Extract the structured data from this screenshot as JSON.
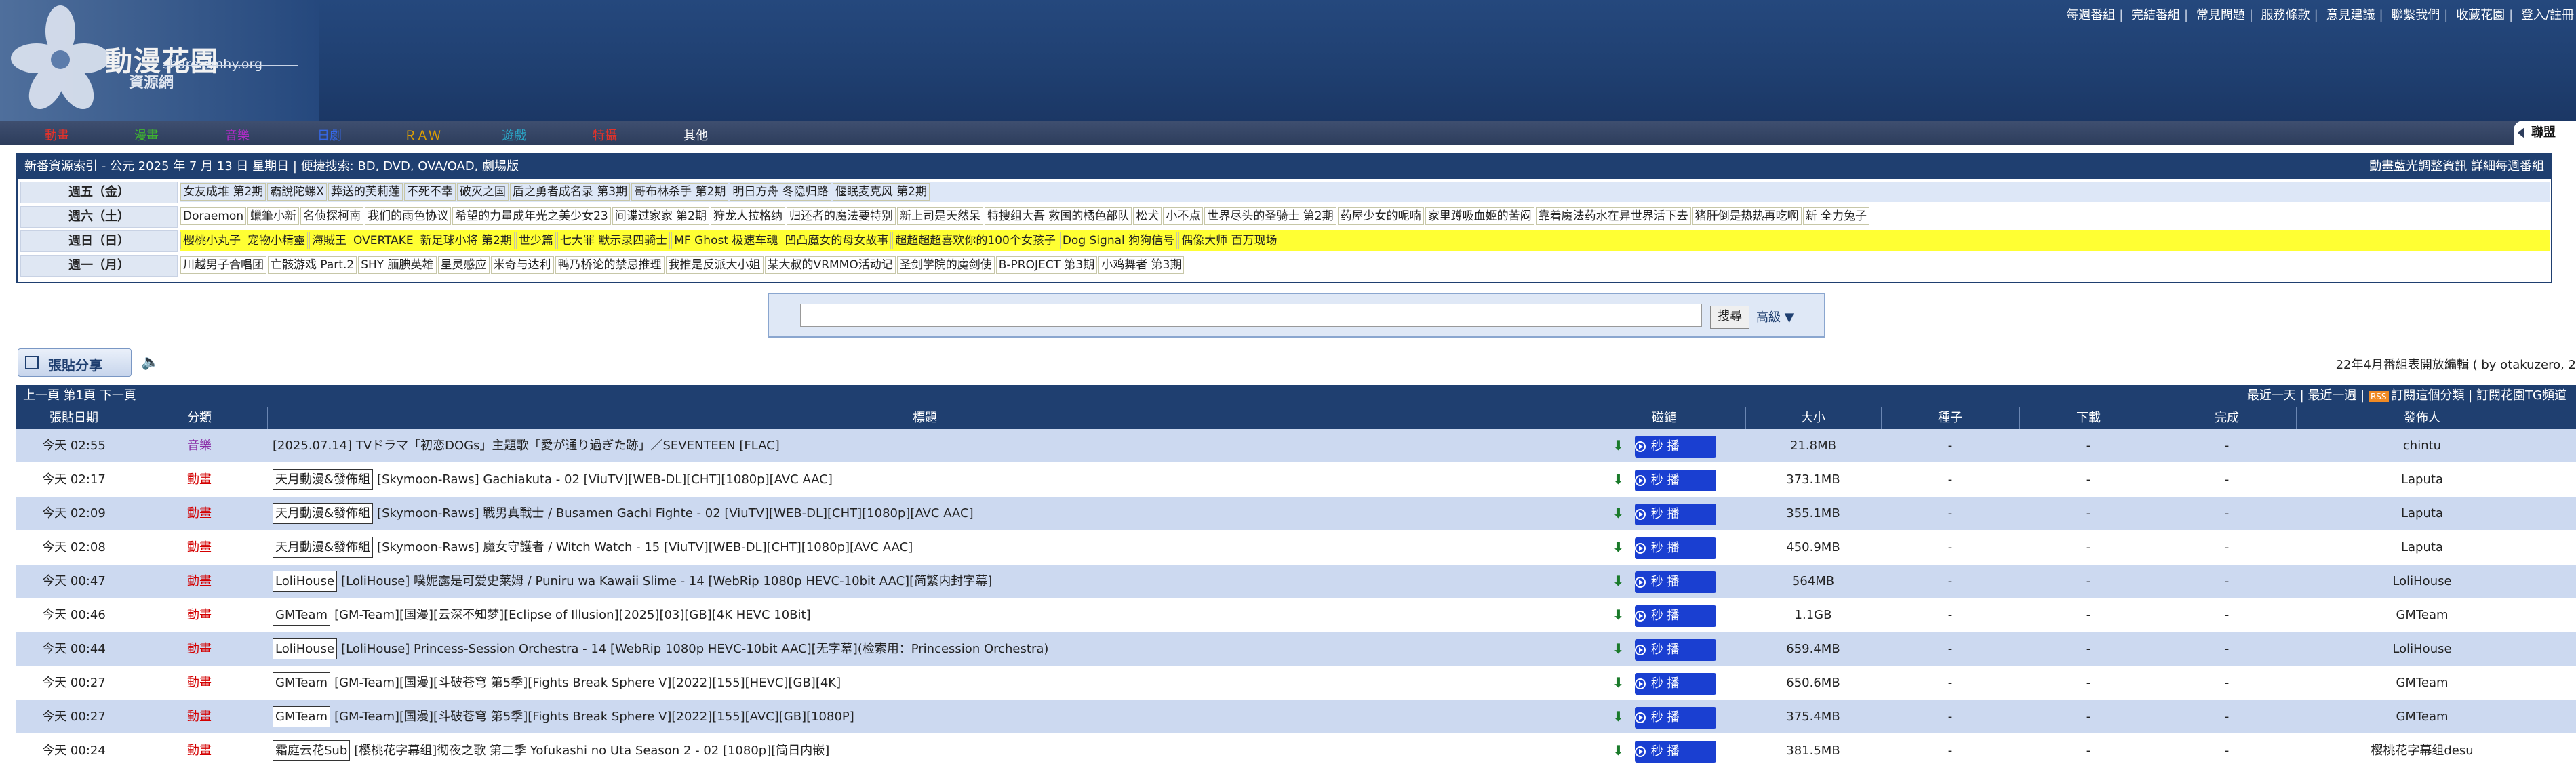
{
  "logo": {
    "title": "動漫花園",
    "sub": "資源網",
    "url": "share.dmhy.org"
  },
  "toplinks": [
    "每週番組",
    "完結番組",
    "常見問題",
    "服務條款",
    "意見建議",
    "聯繫我們",
    "收藏花園",
    "登入/註冊"
  ],
  "nav": [
    {
      "label": "動畫",
      "color": "#e5322a"
    },
    {
      "label": "漫畫",
      "color": "#3fb52f"
    },
    {
      "label": "音樂",
      "color": "#b22bc8"
    },
    {
      "label": "日劇",
      "color": "#3568e8"
    },
    {
      "label": "ＲＡＷ",
      "color": "#e0a000"
    },
    {
      "label": "遊戲",
      "color": "#2aa8c8"
    },
    {
      "label": "特攝",
      "color": "#e0322a"
    },
    {
      "label": "其他",
      "color": "#ffffff"
    }
  ],
  "nav_right": "聯盟",
  "schedule": {
    "header": "新番資源索引 - 公元 2025 年 7 月 13 日 星期日 | 便捷搜索: BD, DVD, OVA/OAD, 劇場版",
    "header_right": "動畫藍光調整資訊 詳細每週番組",
    "rows": [
      {
        "day": "週五（金）",
        "bg": "#dde7f7",
        "items": [
          "女友成堆 第2期",
          "霸說陀螺X",
          "葬送的芙莉莲",
          "不死不幸",
          "破灭之国",
          "盾之勇者成名录 第3期",
          "哥布林杀手 第2期",
          "明日方舟 冬隐归路",
          "偃眠麦克风 第2期"
        ]
      },
      {
        "day": "週六（土）",
        "bg": "#ffffff",
        "items": [
          "Doraemon",
          "蠟筆小新",
          "名侦探柯南",
          "我们的雨色协议",
          "希望的力量成年光之美少女23",
          "间谍过家家 第2期",
          "狩龙人拉格纳",
          "归还者的魔法要特别",
          "新上司是天然呆",
          "特搜组大吾 救国的橘色部队",
          "松犬",
          "小不点",
          "世界尽头的圣骑士 第2期",
          "药屋少女的呢喃",
          "家里蹲吸血姬的苦闷",
          "靠着魔法药水在异世界活下去",
          "猪肝倒是热热再吃啊",
          "新 全力兔子"
        ]
      },
      {
        "day": "週日（日）",
        "bg": "#ffff33",
        "items": [
          "樱桃小丸子",
          "宠物小精靈",
          "海賊王",
          "OVERTAKE",
          "新足球小将 第2期",
          "世少篇",
          "七大罪 默示录四骑士",
          "MF Ghost 极速车魂",
          "凹凸魔女的母女故事",
          "超超超超喜欢你的100个女孩子",
          "Dog Signal 狗狗信号",
          "偶像大师 百万现场"
        ]
      },
      {
        "day": "週一（月）",
        "bg": "#ffffff",
        "items": [
          "川越男子合唱团",
          "亡骸游戏 Part.2",
          "SHY 腼腆英雄",
          "星灵感应",
          "米奇与达利",
          "鸭乃桥论的禁忌推理",
          "我推是反派大小姐",
          "某大叔的VRMMO活动记",
          "圣剑学院的魔剑使",
          "B-PROJECT 第3期",
          "小鸡舞者 第3期"
        ]
      }
    ]
  },
  "search": {
    "button": "搜尋",
    "advanced": "高級 ▼"
  },
  "post_button": "張貼分享",
  "editor_note": "22年4月番組表開放編輯 ( by otakuzero, 2",
  "pager": {
    "left": "上一頁 第1頁 下一頁",
    "right_items": [
      "最近一天",
      "最近一週"
    ],
    "rss": "RSS",
    "subscribe": "訂閱這個分類",
    "tg": "訂閱花園TG頻道"
  },
  "columns": [
    "張貼日期",
    "分類",
    "標題",
    "磁鏈",
    "大小",
    "種子",
    "下載",
    "完成",
    "發佈人"
  ],
  "play_label": "秒 播",
  "rows": [
    {
      "date": "今天 02:55",
      "cat": "音樂",
      "cat_color": "#8a2ba6",
      "team": "",
      "title": "[2025.07.14] TVドラマ「初恋DOGs」主題歌「愛が通り過ぎた跡」／SEVENTEEN [FLAC]",
      "size": "21.8MB",
      "seed": "-",
      "dl": "-",
      "done": "-",
      "user": "chintu"
    },
    {
      "date": "今天 02:17",
      "cat": "動畫",
      "cat_color": "#d40000",
      "team": "天月動漫&發佈組",
      "title": "[Skymoon-Raws] Gachiakuta - 02 [ViuTV][WEB-DL][CHT][1080p][AVC AAC]",
      "size": "373.1MB",
      "seed": "-",
      "dl": "-",
      "done": "-",
      "user": "Laputa"
    },
    {
      "date": "今天 02:09",
      "cat": "動畫",
      "cat_color": "#d40000",
      "team": "天月動漫&發佈組",
      "title": "[Skymoon-Raws] 戰男真戰士 / Busamen Gachi Fighte - 02 [ViuTV][WEB-DL][CHT][1080p][AVC AAC]",
      "size": "355.1MB",
      "seed": "-",
      "dl": "-",
      "done": "-",
      "user": "Laputa"
    },
    {
      "date": "今天 02:08",
      "cat": "動畫",
      "cat_color": "#d40000",
      "team": "天月動漫&發佈組",
      "title": "[Skymoon-Raws] 魔女守護者 / Witch Watch - 15 [ViuTV][WEB-DL][CHT][1080p][AVC AAC]",
      "size": "450.9MB",
      "seed": "-",
      "dl": "-",
      "done": "-",
      "user": "Laputa"
    },
    {
      "date": "今天 00:47",
      "cat": "動畫",
      "cat_color": "#d40000",
      "team": "LoliHouse",
      "title": "[LoliHouse] 噗妮露是可爱史莱姆 / Puniru wa Kawaii Slime - 14 [WebRip 1080p HEVC-10bit AAC][简繁内封字幕]",
      "size": "564MB",
      "seed": "-",
      "dl": "-",
      "done": "-",
      "user": "LoliHouse"
    },
    {
      "date": "今天 00:46",
      "cat": "動畫",
      "cat_color": "#d40000",
      "team": "GMTeam",
      "title": "[GM-Team][国漫][云深不知梦][Eclipse of Illusion][2025][03][GB][4K HEVC 10Bit]",
      "size": "1.1GB",
      "seed": "-",
      "dl": "-",
      "done": "-",
      "user": "GMTeam"
    },
    {
      "date": "今天 00:44",
      "cat": "動畫",
      "cat_color": "#d40000",
      "team": "LoliHouse",
      "title": "[LoliHouse] Princess-Session Orchestra - 14 [WebRip 1080p HEVC-10bit AAC][无字幕](检索用：Princession Orchestra)",
      "size": "659.4MB",
      "seed": "-",
      "dl": "-",
      "done": "-",
      "user": "LoliHouse"
    },
    {
      "date": "今天 00:27",
      "cat": "動畫",
      "cat_color": "#d40000",
      "team": "GMTeam",
      "title": "[GM-Team][国漫][斗破苍穹 第5季][Fights Break Sphere Ⅴ][2022][155][HEVC][GB][4K]",
      "size": "650.6MB",
      "seed": "-",
      "dl": "-",
      "done": "-",
      "user": "GMTeam"
    },
    {
      "date": "今天 00:27",
      "cat": "動畫",
      "cat_color": "#d40000",
      "team": "GMTeam",
      "title": "[GM-Team][国漫][斗破苍穹 第5季][Fights Break Sphere Ⅴ][2022][155][AVC][GB][1080P]",
      "size": "375.4MB",
      "seed": "-",
      "dl": "-",
      "done": "-",
      "user": "GMTeam"
    },
    {
      "date": "今天 00:24",
      "cat": "動畫",
      "cat_color": "#d40000",
      "team": "霜庭云花Sub",
      "title": "[樱桃花字幕组]彻夜之歌 第二季 Yofukashi no Uta Season 2 - 02 [1080p][简日内嵌]",
      "size": "381.5MB",
      "seed": "-",
      "dl": "-",
      "done": "-",
      "user": "樱桃花字幕组desu"
    }
  ]
}
